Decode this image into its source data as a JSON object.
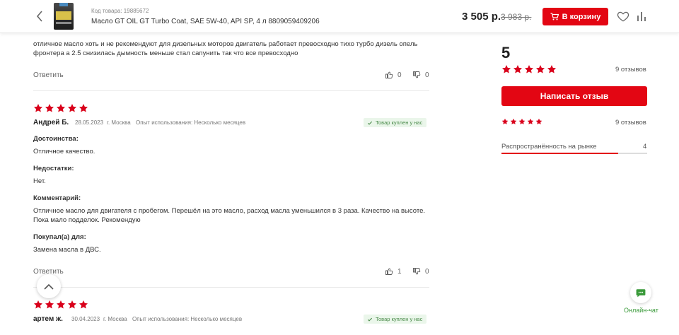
{
  "header": {
    "code_label": "Код товара: 19885672",
    "title": "Масло GT OIL GT Turbo Coat, SAE 5W-40, API SP, 4 л 8809059409206",
    "price": "3 505 р.",
    "old_price": "3 983 р.",
    "cart_label": "В корзину",
    "icons": [
      "back-arrow-icon",
      "heart-icon",
      "compare-icon",
      "cart-icon"
    ]
  },
  "reviews": [
    {
      "comment_tail": "отличное масло хоть и не рекомендуют для дизельных моторов двигатель работает превосходно тихо турбо дизель опель фронтера а 2.5 снизилась дымность меньше стал сапунить так что все превосходно",
      "reply": "Ответить",
      "likes": "0",
      "dislikes": "0"
    },
    {
      "rating": 5,
      "author": "Андрей Б.",
      "date": "28.05.2023",
      "city": "г. Москва",
      "experience": "Опыт использования: Несколько месяцев",
      "badge": "Товар куплен у нас",
      "pros_label": "Достоинства:",
      "pros": "Отличное качество.",
      "cons_label": "Недостатки:",
      "cons": "Нет.",
      "comment_label": "Комментарий:",
      "comment": "Отличное масло для двигателя с пробегом. Перешёл на это масло, расход масла уменьшился в 3 раза. Качество на высоте. Пока мало подделок. Рекомендую",
      "purpose_label": "Покупал(а) для:",
      "purpose": "Замена масла в ДВС.",
      "reply": "Ответить",
      "likes": "1",
      "dislikes": "0"
    },
    {
      "rating": 5,
      "author": "артем ж.",
      "date": "30.04.2023",
      "city": "г. Москва",
      "experience": "Опыт использования: Несколько месяцев",
      "badge": "Товар куплен у нас"
    }
  ],
  "sidebar": {
    "rating": "5",
    "reviews_count": "9 отзывов",
    "write_label": "Написать отзыв",
    "breakdown_count": "9 отзывов",
    "market_label": "Распространённость на рынке",
    "market_value": "4",
    "market_fraction": 0.8
  },
  "chat": {
    "label": "Онлайн-чат"
  },
  "colors": {
    "accent": "#e30613",
    "badge_bg": "#eaf6ea",
    "badge_text": "#4a8a4a",
    "chat": "#3a9a3a"
  }
}
